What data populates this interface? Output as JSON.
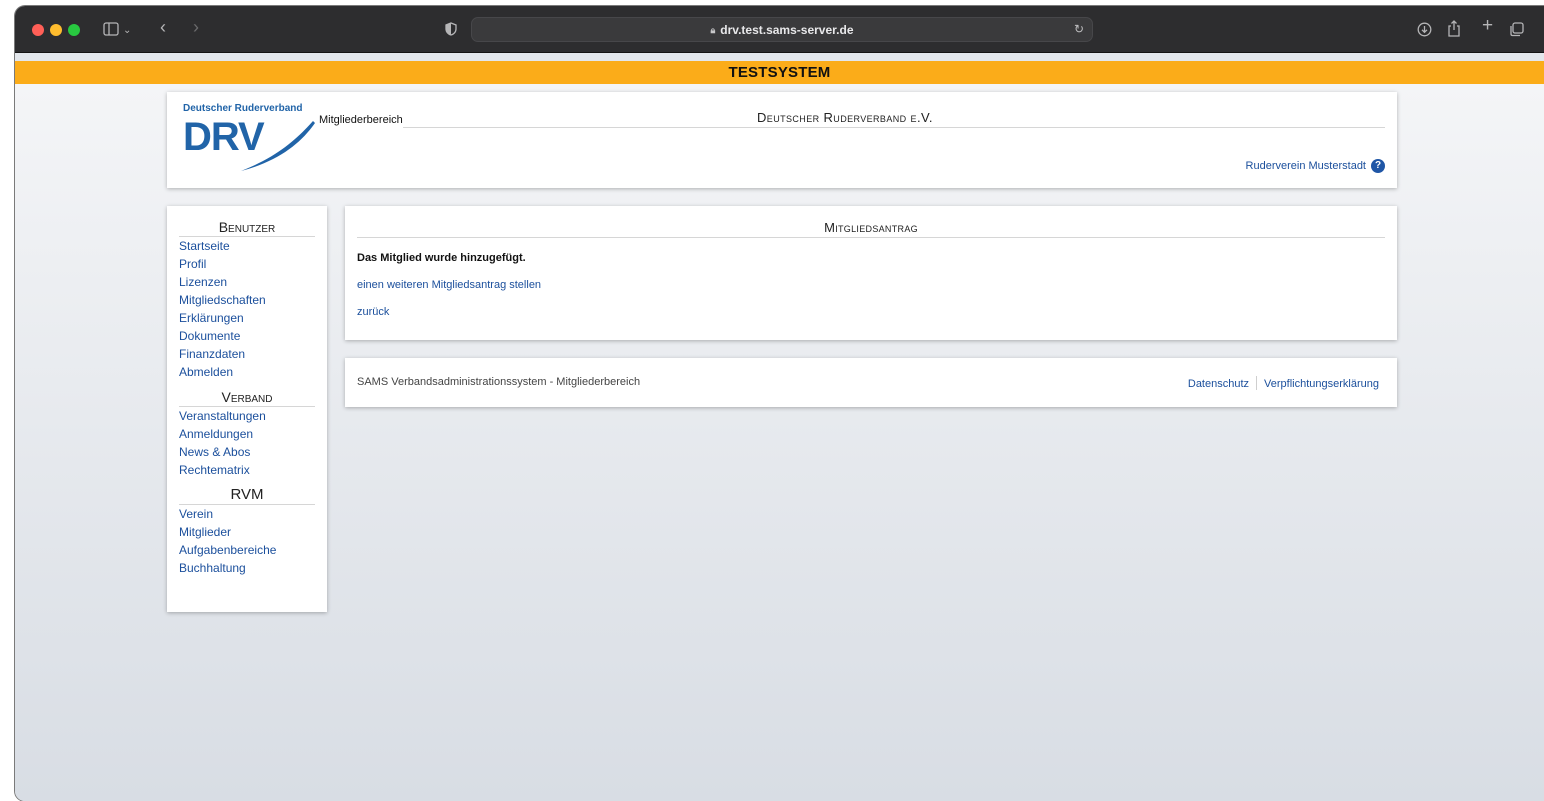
{
  "browser": {
    "url": "drv.test.sams-server.de"
  },
  "banner": {
    "text": "TESTSYSTEM"
  },
  "header": {
    "logo_text": "Deutscher Ruderverband",
    "logo_abbr": "DRV",
    "area": "Mitgliederbereich",
    "title": "Deutscher Ruderverband e.V.",
    "club": "Ruderverein Musterstadt"
  },
  "sidebar": {
    "sections": [
      {
        "heading": "Benutzer",
        "items": [
          "Startseite",
          "Profil",
          "Lizenzen",
          "Mitgliedschaften",
          "Erklärungen",
          "Dokumente",
          "Finanzdaten",
          "Abmelden"
        ]
      },
      {
        "heading": "Verband",
        "items": [
          "Veranstaltungen",
          "Anmeldungen",
          "News & Abos",
          "Rechtematrix"
        ]
      },
      {
        "heading": "RVM",
        "items": [
          "Verein",
          "Mitglieder",
          "Aufgabenbereiche",
          "Buchhaltung"
        ]
      }
    ]
  },
  "main": {
    "title": "Mitgliedsantrag",
    "message": "Das Mitglied wurde hinzugefügt.",
    "link_again": "einen weiteren Mitgliedsantrag stellen",
    "link_back": "zurück"
  },
  "footer": {
    "text": "SAMS Verbandsadministrationssystem - Mitgliederbereich",
    "link_privacy": "Datenschutz",
    "link_commitment": "Verpflichtungserklärung"
  }
}
